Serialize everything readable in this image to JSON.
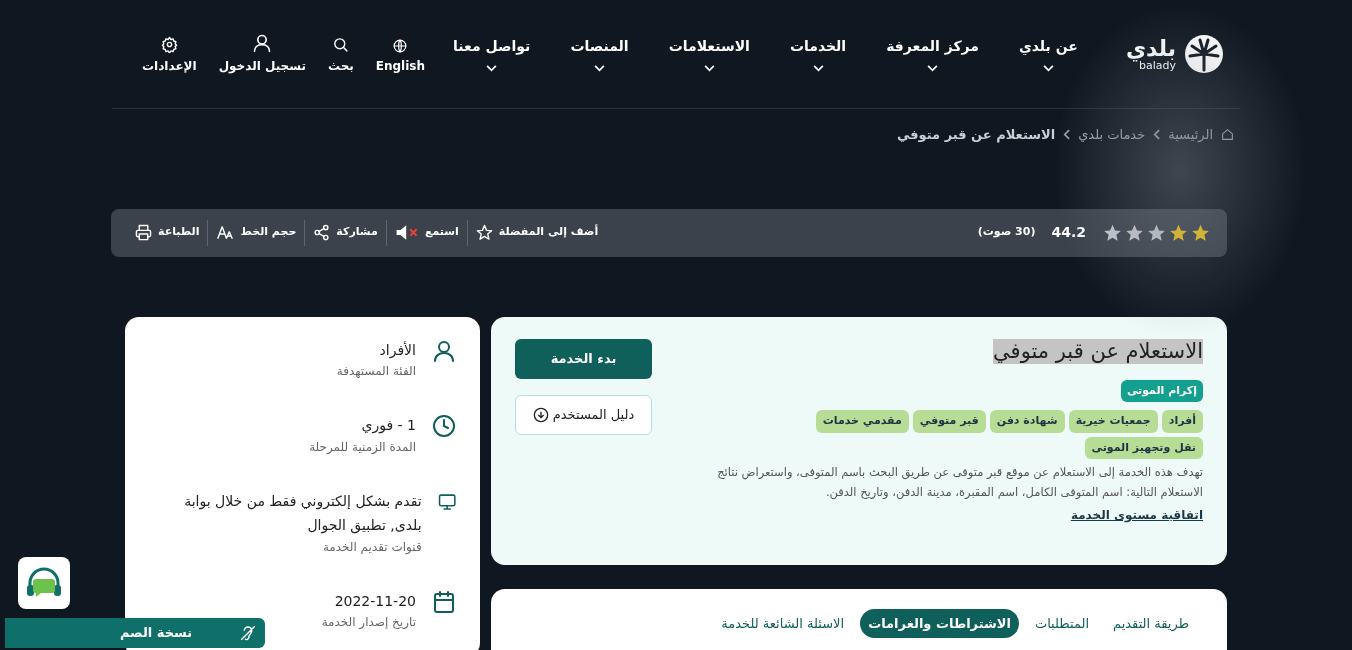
{
  "header": {
    "logo": {
      "arabic": "بلدي",
      "latin": "balady"
    },
    "nav": [
      {
        "label": "عن بلدي"
      },
      {
        "label": "مركز المعرفة"
      },
      {
        "label": "الخدمات"
      },
      {
        "label": "الاستعلامات"
      },
      {
        "label": "المنصات"
      },
      {
        "label": "تواصل معنا"
      }
    ],
    "tools": [
      {
        "kind": "language",
        "label": "English"
      },
      {
        "kind": "search",
        "label": "بحث"
      },
      {
        "kind": "user",
        "label": "تسجيل الدخول"
      },
      {
        "kind": "settings",
        "label": "الإعدادات"
      }
    ]
  },
  "breadcrumb": [
    {
      "label": "الرئيسية"
    },
    {
      "label": "خدمات بلدي"
    },
    {
      "label": "الاستعلام عن قبر متوفي"
    }
  ],
  "toolbar": {
    "rating": {
      "stars": 2,
      "score": "44.2",
      "votes": "(30 صوت)"
    },
    "actions": [
      {
        "kind": "favorite",
        "label": "أضف إلى المفضلة"
      },
      {
        "kind": "listen",
        "label": "استمع"
      },
      {
        "kind": "share",
        "label": "مشاركة"
      },
      {
        "kind": "font",
        "label": "حجم الخط"
      },
      {
        "kind": "print",
        "label": "الطباعة"
      }
    ]
  },
  "service": {
    "title": "الاستعلام عن قبر متوفي",
    "category": "إكرام الموتى",
    "tags": [
      "أفراد",
      "جمعيات خيرية",
      "شهادة دفن",
      "قبر متوفي",
      "مقدمي خدمات",
      "نقل وتجهيز الموتى"
    ],
    "description": "تهدف هذه الخدمة إلى الاستعلام عن موقع قبر متوفى عن طريق البحث باسم المتوفى، واستعراض نتائج الاستعلام التالية: اسم المتوفى الكامل، اسم المقبرة، مدينة الدفن، وتاريخ الدفن.",
    "sla_link": "اتفاقية مستوى الخدمة",
    "start_button": "بدء الخدمة",
    "guide_button": "دليل المستخدم"
  },
  "info": [
    {
      "kind": "user",
      "value": "الأفراد",
      "label": "الفئة المستهدفة"
    },
    {
      "kind": "clock",
      "value": "1 - فوري",
      "label": "المدة الزمنية للمرحلة"
    },
    {
      "kind": "monitor",
      "value": "تقدم بشكل إلكتروني فقط من خلال بوابة بلدى, تطبيق الجوال",
      "label": "قنوات تقديم الخدمة"
    },
    {
      "kind": "calendar",
      "value": "2022-11-20",
      "label": "تاريخ إصدار الخدمة"
    }
  ],
  "tabs": [
    {
      "label": "طريقة التقديم",
      "selected": false
    },
    {
      "label": "المتطلبات",
      "selected": false
    },
    {
      "label": "الاشتراطات والغرامات",
      "selected": true
    },
    {
      "label": "الاسئلة الشائعة للخدمة",
      "selected": false
    }
  ],
  "deaf_bar": {
    "label": "نسخة الصم"
  }
}
